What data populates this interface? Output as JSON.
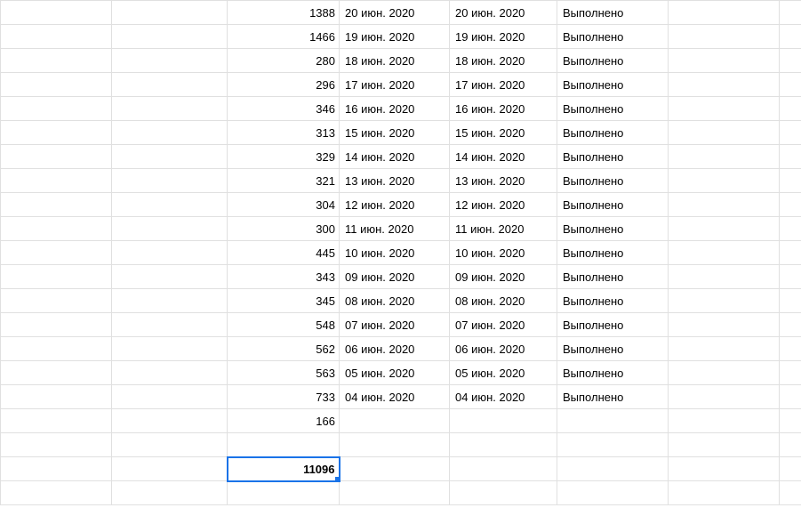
{
  "rows": [
    {
      "c": "1388",
      "d": "20 июн. 2020",
      "e": "20 июн. 2020",
      "f": "Выполнено"
    },
    {
      "c": "1466",
      "d": "19 июн. 2020",
      "e": "19 июн. 2020",
      "f": "Выполнено"
    },
    {
      "c": "280",
      "d": "18 июн. 2020",
      "e": "18 июн. 2020",
      "f": "Выполнено"
    },
    {
      "c": "296",
      "d": "17 июн. 2020",
      "e": "17 июн. 2020",
      "f": "Выполнено"
    },
    {
      "c": "346",
      "d": "16 июн. 2020",
      "e": "16 июн. 2020",
      "f": "Выполнено"
    },
    {
      "c": "313",
      "d": "15 июн. 2020",
      "e": "15 июн. 2020",
      "f": "Выполнено"
    },
    {
      "c": "329",
      "d": "14 июн. 2020",
      "e": "14 июн. 2020",
      "f": "Выполнено"
    },
    {
      "c": "321",
      "d": "13 июн. 2020",
      "e": "13 июн. 2020",
      "f": "Выполнено"
    },
    {
      "c": "304",
      "d": "12 июн. 2020",
      "e": "12 июн. 2020",
      "f": "Выполнено"
    },
    {
      "c": "300",
      "d": "11 июн. 2020",
      "e": "11 июн. 2020",
      "f": "Выполнено"
    },
    {
      "c": "445",
      "d": "10 июн. 2020",
      "e": "10 июн. 2020",
      "f": "Выполнено"
    },
    {
      "c": "343",
      "d": "09 июн. 2020",
      "e": "09 июн. 2020",
      "f": "Выполнено"
    },
    {
      "c": "345",
      "d": "08 июн. 2020",
      "e": "08 июн. 2020",
      "f": "Выполнено"
    },
    {
      "c": "548",
      "d": "07 июн. 2020",
      "e": "07 июн. 2020",
      "f": "Выполнено"
    },
    {
      "c": "562",
      "d": "06 июн. 2020",
      "e": "06 июн. 2020",
      "f": "Выполнено"
    },
    {
      "c": "563",
      "d": "05 июн. 2020",
      "e": "05 июн. 2020",
      "f": "Выполнено"
    },
    {
      "c": "733",
      "d": "04 июн. 2020",
      "e": "04 июн. 2020",
      "f": "Выполнено"
    },
    {
      "c": "166",
      "d": "",
      "e": "",
      "f": ""
    }
  ],
  "blank_row": {
    "c": "",
    "d": "",
    "e": "",
    "f": ""
  },
  "total": "11096",
  "extra_row": {
    "c": "",
    "d": "",
    "e": "",
    "f": ""
  }
}
